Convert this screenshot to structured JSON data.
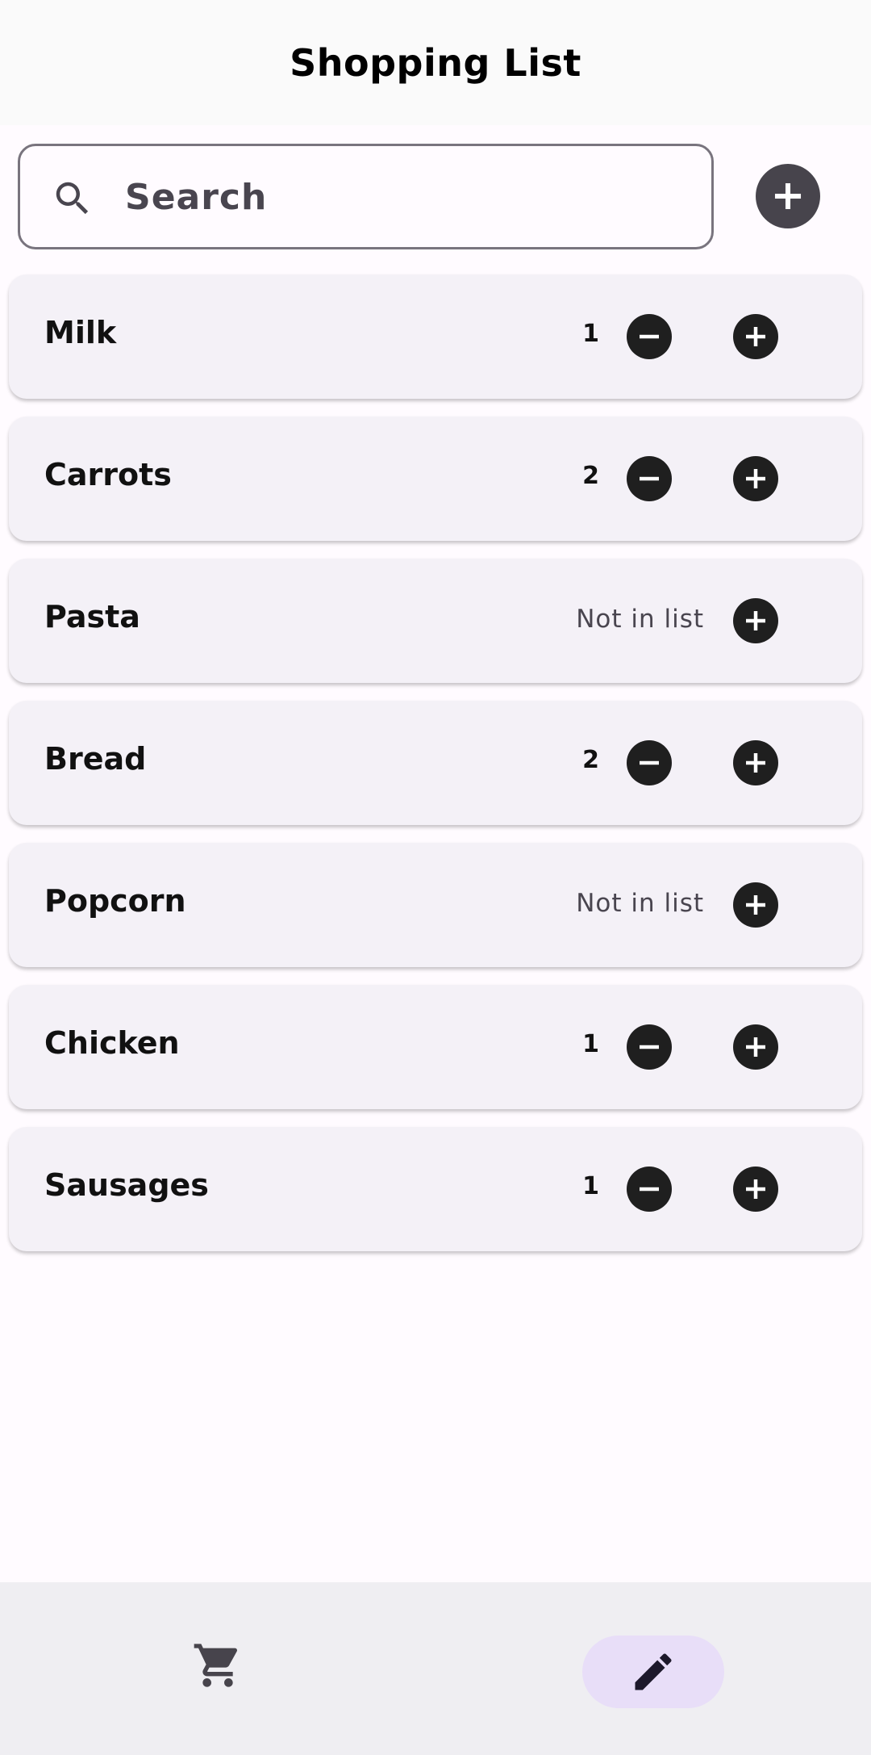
{
  "app_bar": {
    "title": "Shopping List"
  },
  "search": {
    "placeholder": "Search",
    "value": ""
  },
  "items": [
    {
      "name": "Milk",
      "quantity": "1",
      "in_list": true
    },
    {
      "name": "Carrots",
      "quantity": "2",
      "in_list": true
    },
    {
      "name": "Pasta",
      "status": "Not in list",
      "in_list": false
    },
    {
      "name": "Bread",
      "quantity": "2",
      "in_list": true
    },
    {
      "name": "Popcorn",
      "status": "Not in list",
      "in_list": false
    },
    {
      "name": "Chicken",
      "quantity": "1",
      "in_list": true
    },
    {
      "name": "Sausages",
      "quantity": "1",
      "in_list": true
    }
  ],
  "bottom_nav": {
    "items": [
      {
        "icon": "shopping-cart-icon",
        "selected": false
      },
      {
        "icon": "pencil-icon",
        "selected": true
      }
    ]
  },
  "colors": {
    "card_background": "#f4f1f7",
    "nav_selected": "#e8def8",
    "button_dark": "#1f1f1f",
    "add_button": "#47444c"
  }
}
